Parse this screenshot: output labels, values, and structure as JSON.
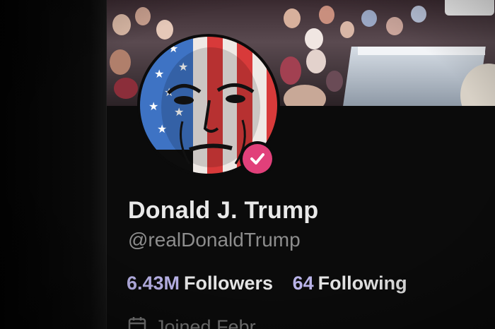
{
  "profile": {
    "display_name": "Donald J. Trump",
    "handle": "@realDonaldTrump",
    "verified_icon": "verified-check-icon",
    "badge_color": "#e1407a",
    "joined_text": "Joined Febr"
  },
  "stats": [
    {
      "key": "followers",
      "value": "6.43M",
      "label": "Followers"
    },
    {
      "key": "following",
      "value": "64",
      "label": "Following"
    }
  ],
  "colors": {
    "stat_number": "#b9b3e8",
    "name_text": "#e9e9e9",
    "handle_text": "#8d8d8d"
  },
  "icons": {
    "calendar": "calendar-icon"
  }
}
